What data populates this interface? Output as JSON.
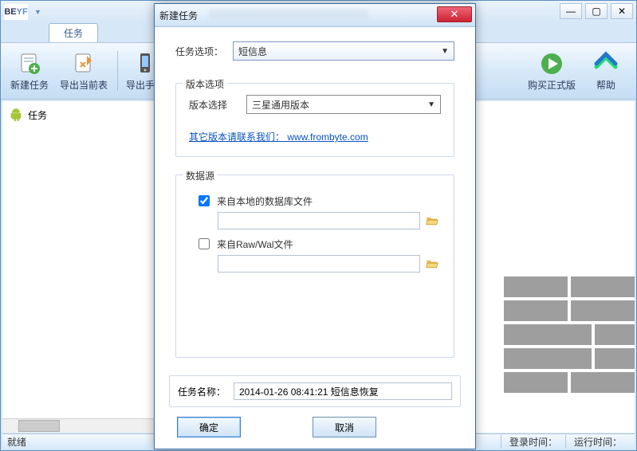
{
  "main": {
    "tab": "任务",
    "tools": {
      "new_task": "新建任务",
      "export_table": "导出当前表",
      "export_phone": "导出手机",
      "buy": "购买正式版",
      "help": "帮助"
    },
    "tree_root": "任务",
    "status_ready": "就绪",
    "status_login": "登录时间：",
    "status_run": "运行时间："
  },
  "dialog": {
    "title": "新建任务",
    "task_option_label": "任务选项：",
    "task_option_value": "短信息",
    "version_group": "版本选项",
    "version_label": "版本选择",
    "version_value": "三星通用版本",
    "link_text": "其它版本请联系我们： www.frombyte.com",
    "source_group": "数据源",
    "chk_local": "来自本地的数据库文件",
    "chk_rawwal": "来自Raw/Wal文件",
    "task_name_label": "任务名称：",
    "task_name_value": "2014-01-26 08:41:21 短信息恢复",
    "ok": "确定",
    "cancel": "取消"
  }
}
